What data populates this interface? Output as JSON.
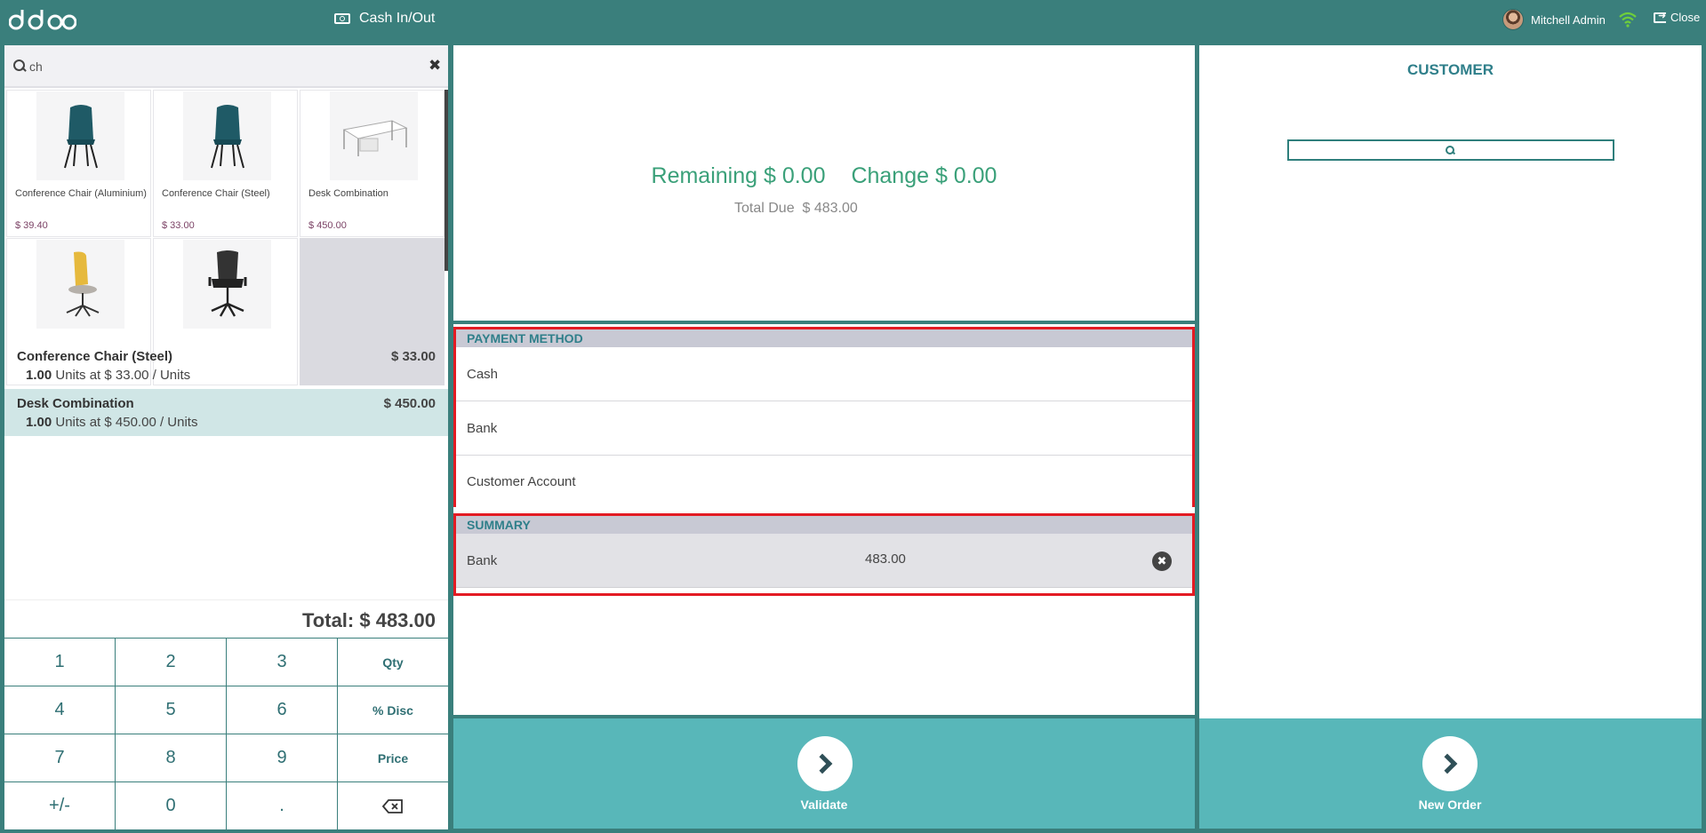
{
  "header": {
    "logo_text": "odoo",
    "cash_in_out_label": "Cash In/Out",
    "user_name": "Mitchell Admin",
    "close_label": "Close"
  },
  "search": {
    "value": "ch"
  },
  "products": [
    {
      "name": "Conference Chair (Aluminium)",
      "price": "$ 39.40",
      "icon": "teal-chair"
    },
    {
      "name": "Conference Chair (Steel)",
      "price": "$ 33.00",
      "icon": "teal-chair"
    },
    {
      "name": "Desk Combination",
      "price": "$ 450.00",
      "icon": "desk"
    },
    {
      "name": "",
      "price": "",
      "icon": "yellow-office-chair"
    },
    {
      "name": "",
      "price": "",
      "icon": "black-office-chair"
    }
  ],
  "orderlines": [
    {
      "name": "Conference Chair (Steel)",
      "price": "$ 33.00",
      "qty": "1.00",
      "info": "Units at $ 33.00 / Units"
    },
    {
      "name": "Desk Combination",
      "price": "$ 450.00",
      "qty": "1.00",
      "info": "Units at $ 450.00 / Units"
    }
  ],
  "total_label": "Total: $ 483.00",
  "numpad": [
    "1",
    "2",
    "3",
    "Qty",
    "4",
    "5",
    "6",
    "% Disc",
    "7",
    "8",
    "9",
    "Price",
    "+/-",
    "0",
    "."
  ],
  "payment": {
    "remaining": "Remaining $ 0.00",
    "change": "Change $ 0.00",
    "total_due_label": "Total Due",
    "total_due_value": "$ 483.00",
    "method_title": "PAYMENT METHOD",
    "methods": [
      "Cash",
      "Bank",
      "Customer Account"
    ],
    "summary_title": "SUMMARY",
    "summary_method": "Bank",
    "summary_amount": "483.00",
    "validate_label": "Validate"
  },
  "customer": {
    "title": "CUSTOMER",
    "new_order_label": "New Order"
  },
  "colors": {
    "header": "#3a7f7c",
    "accent": "#58b7b9",
    "green_text": "#3aa079",
    "highlight_box": "#e31b23"
  }
}
